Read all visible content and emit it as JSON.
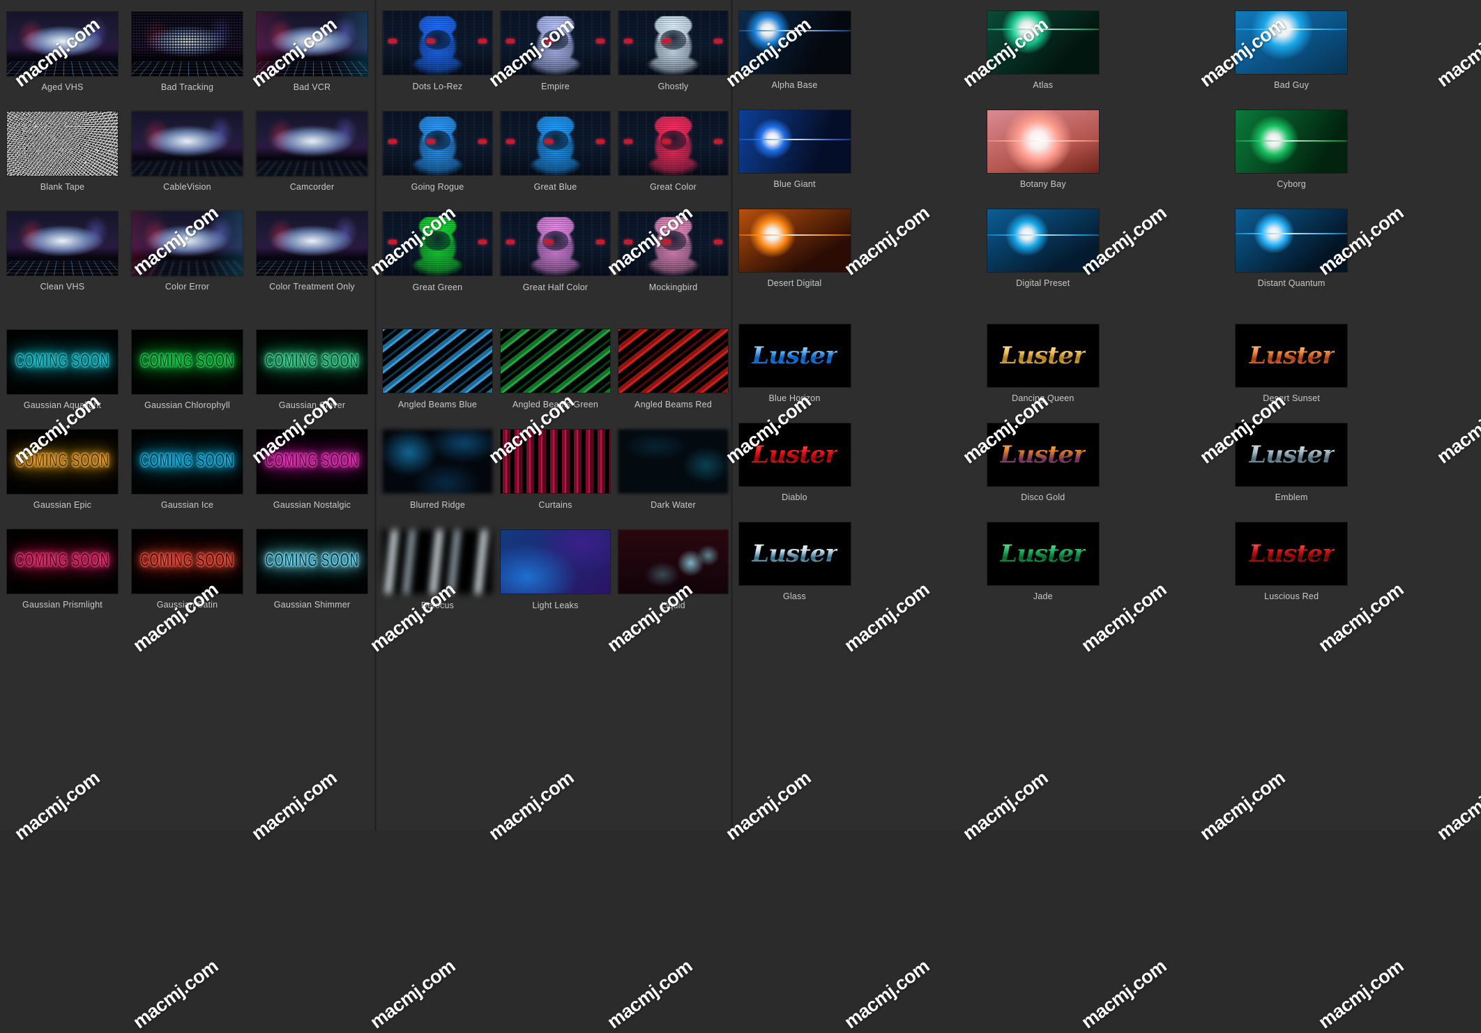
{
  "watermark": {
    "text": "macmj.com"
  },
  "theme": {
    "background": "#2b2b2b",
    "panel_background": "#2e2e2e",
    "caption_color": "#c9c9c9",
    "divider_color": "#232323"
  },
  "panels": [
    {
      "id": "vhs-panel",
      "sections": [
        {
          "id": "vhs-looks",
          "items": [
            {
              "label": "Aged VHS",
              "art": "vhs"
            },
            {
              "label": "Bad Tracking",
              "art": "vhs-dots"
            },
            {
              "label": "Bad VCR",
              "art": "vhs-chroma"
            },
            {
              "label": "Blank Tape",
              "art": "noise"
            },
            {
              "label": "CableVision",
              "art": "vhs-soft"
            },
            {
              "label": "Camcorder",
              "art": "vhs-soft"
            },
            {
              "label": "Clean VHS",
              "art": "vhs"
            },
            {
              "label": "Color Error",
              "art": "vhs-blur"
            },
            {
              "label": "Color Treatment Only",
              "art": "vhs"
            }
          ]
        },
        {
          "id": "gaussian-glows",
          "items": [
            {
              "label": "Gaussian Aqualight",
              "art": "coming-soon",
              "glow": "#28d8e0",
              "fill": "#0b4a52"
            },
            {
              "label": "Gaussian Chlorophyll",
              "art": "coming-soon",
              "glow": "#25e05a",
              "fill": "#0a4a1c"
            },
            {
              "label": "Gaussian Clover",
              "art": "coming-soon",
              "glow": "#49e9a0",
              "fill": "#0d4a38"
            },
            {
              "label": "Gaussian Epic",
              "art": "coming-soon",
              "glow": "#ffb43c",
              "fill": "#5a3a06"
            },
            {
              "label": "Gaussian Ice",
              "art": "coming-soon",
              "glow": "#22c8f5",
              "fill": "#06384f"
            },
            {
              "label": "Gaussian Nostalgic",
              "art": "coming-soon",
              "glow": "#ff3ecb",
              "fill": "#5a0a45"
            },
            {
              "label": "Gaussian Prismlight",
              "art": "coming-soon",
              "glow": "#ff3b7a",
              "fill": "#4d0a2c"
            },
            {
              "label": "Gaussian Satin",
              "art": "coming-soon",
              "glow": "#ff5a4a",
              "fill": "#521208"
            },
            {
              "label": "Gaussian Shimmer",
              "art": "coming-soon",
              "glow": "#7fe8ff",
              "fill": "#0d3b4a"
            }
          ]
        }
      ]
    },
    {
      "id": "hologram-panel",
      "sections": [
        {
          "id": "hologram-looks",
          "items": [
            {
              "label": "Dots Lo-Rez",
              "art": "holo",
              "tint": "#1d6dff",
              "eyes": 3
            },
            {
              "label": "Empire",
              "art": "holo",
              "tint": "#b9c4ff",
              "eyes": 3
            },
            {
              "label": "Ghostly",
              "art": "holo",
              "tint": "#dff3ff",
              "eyes": 3
            },
            {
              "label": "Going Rogue",
              "art": "holo",
              "tint": "#2a9bff",
              "eyes": 3
            },
            {
              "label": "Great Blue",
              "art": "holo",
              "tint": "#1e9dff",
              "eyes": 3
            },
            {
              "label": "Great Color",
              "art": "holo",
              "tint": "#ff2b5e",
              "eyes": 3
            },
            {
              "label": "Great Green",
              "art": "holo",
              "tint": "#16e033",
              "eyes": 2
            },
            {
              "label": "Great Half Color",
              "art": "holo",
              "tint": "#e98ae8",
              "eyes": 3
            },
            {
              "label": "Mockingbird",
              "art": "holo",
              "tint": "#f08fc4",
              "eyes": 3
            }
          ]
        },
        {
          "id": "background-looks",
          "items": [
            {
              "label": "Angled Beams Blue",
              "art": "beams",
              "color": "#2f9fe0"
            },
            {
              "label": "Angled Beams Green",
              "art": "beams",
              "color": "#1faa3f"
            },
            {
              "label": "Angled Beams Red",
              "art": "beams",
              "color": "#d81e18"
            },
            {
              "label": "Blurred Ridge",
              "art": "ridge"
            },
            {
              "label": "Curtains",
              "art": "curtains"
            },
            {
              "label": "Dark Water",
              "art": "darkwater"
            },
            {
              "label": "Defocus",
              "art": "defocus"
            },
            {
              "label": "Light Leaks",
              "art": "leaks"
            },
            {
              "label": "Liquid",
              "art": "liquid"
            }
          ]
        }
      ]
    },
    {
      "id": "flare-luster-panel",
      "sections": [
        {
          "id": "lens-flares",
          "items": [
            {
              "label": "Alpha Base",
              "art": "flare",
              "halo": "#1a7fd4",
              "bg": "linear-gradient(120deg,#0a2a4d,#05080f 70%)",
              "x": "26%",
              "y": "30%",
              "size": "64px"
            },
            {
              "label": "Atlas",
              "art": "flare",
              "halo": "#17c98e",
              "bg": "linear-gradient(135deg,#0b4a38,#02150f 75%)",
              "x": "36%",
              "y": "28%",
              "size": "72px"
            },
            {
              "label": "Bad Guy",
              "art": "flare",
              "halo": "#1aa6e8",
              "bg": "linear-gradient(150deg,#1179bb,#0a4e80 60%,#063352)",
              "x": "42%",
              "y": "28%",
              "size": "88px"
            },
            {
              "label": "Blue Giant",
              "art": "flare",
              "halo": "#1f6fe8",
              "bg": "linear-gradient(110deg,#0d3f96,#050e28 72%)",
              "x": "30%",
              "y": "46%",
              "size": "58px"
            },
            {
              "label": "Botany Bay",
              "art": "flare",
              "halo": "#ff9d8e",
              "bg": "linear-gradient(160deg,#d98b92,#b5554e 62%,#6d2218)",
              "x": "46%",
              "y": "48%",
              "size": "96px"
            },
            {
              "label": "Cyborg",
              "art": "flare",
              "halo": "#17c060",
              "bg": "linear-gradient(120deg,#0a7a3a,#02240f 78%)",
              "x": "34%",
              "y": "48%",
              "size": "70px"
            },
            {
              "label": "Desert Digital",
              "art": "flare",
              "halo": "#ff8a16",
              "bg": "linear-gradient(150deg,#b8500d,#2a0c04 74%)",
              "x": "30%",
              "y": "40%",
              "size": "66px"
            },
            {
              "label": "Digital Preset",
              "art": "flare",
              "halo": "#17a6e8",
              "bg": "linear-gradient(150deg,#0c5d96,#041a2e 78%)",
              "x": "36%",
              "y": "40%",
              "size": "62px"
            },
            {
              "label": "Distant Quantum",
              "art": "flare",
              "halo": "#2bb6ff",
              "bg": "linear-gradient(140deg,#0b5e96,#031425 78%)",
              "x": "34%",
              "y": "38%",
              "size": "58px"
            }
          ]
        },
        {
          "id": "luster-titles",
          "items": [
            {
              "label": "Blue Horizon",
              "art": "luster",
              "word": "Luster",
              "gradient": "linear-gradient(to bottom,#cfe9ff 0%,#5fb2f0 36%,#0a5fc0 58%,#1f8ae0 100%)"
            },
            {
              "label": "Dancing Queen",
              "art": "luster",
              "word": "Luster",
              "gradient": "linear-gradient(to bottom,#fff3d0 0%,#f0c060 38%,#b07a18 60%,#f5d68a 100%)"
            },
            {
              "label": "Desert Sunset",
              "art": "luster",
              "word": "Luster",
              "gradient": "linear-gradient(to bottom,#ffd8b0 0%,#ef8a3a 38%,#a83a10 62%,#f0a860 100%)"
            },
            {
              "label": "Diablo",
              "art": "luster",
              "word": "Luster",
              "gradient": "linear-gradient(to bottom,#ff6a6a 0%,#ee1414 40%,#9a0505 64%,#ff4040 100%)"
            },
            {
              "label": "Disco Gold",
              "art": "luster",
              "word": "Luster",
              "gradient": "linear-gradient(to bottom,#ffc97a 0%,#e07a20 38%,#6a2a66 70%,#f0b050 100%)"
            },
            {
              "label": "Emblem",
              "art": "luster",
              "word": "Luster",
              "gradient": "linear-gradient(to bottom,#e8eef0 0%,#a8bcc4 40%,#496b7a 66%,#cfdde2 100%)"
            },
            {
              "label": "Glass",
              "art": "luster",
              "word": "Luster",
              "gradient": "linear-gradient(to bottom,#ffffff 0%,#cfe2ee 38%,#2e6a88 66%,#e6f2f8 100%)"
            },
            {
              "label": "Jade",
              "art": "luster",
              "word": "Luster",
              "gradient": "linear-gradient(to bottom,#8ef0b0 0%,#1fb55c 40%,#05662c 66%,#49d088 100%)"
            },
            {
              "label": "Luscious Red",
              "art": "luster",
              "word": "Luster",
              "gradient": "linear-gradient(to bottom,#ff8080 0%,#d41414 40%,#6e0606 66%,#f04040 100%)"
            }
          ]
        }
      ]
    }
  ]
}
